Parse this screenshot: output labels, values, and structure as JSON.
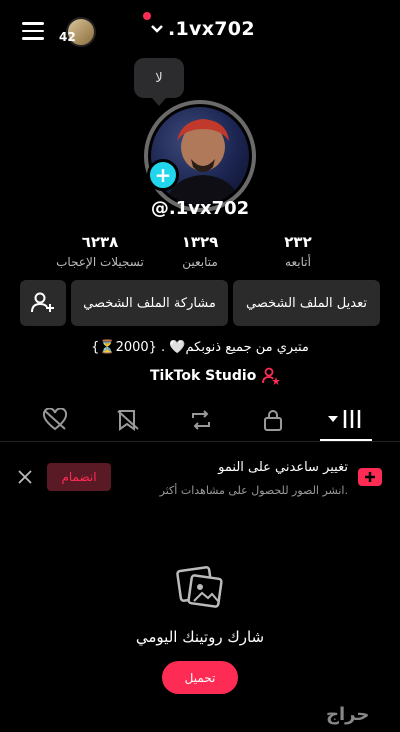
{
  "topbar": {
    "notification_count": "42",
    "username": ".1vx702"
  },
  "story_bubble": {
    "text": "لا"
  },
  "profile": {
    "handle": "@.1vx702"
  },
  "stats": [
    {
      "value": "٦٢٣٨",
      "label": "تسجيلات الإعجاب"
    },
    {
      "value": "١٣٢٩",
      "label": "متابعين"
    },
    {
      "value": "٢٣٢",
      "label": "أتابعه"
    }
  ],
  "actions": {
    "edit_profile": "تعديل الملف الشخصي",
    "share_profile": "مشاركة الملف الشخصي"
  },
  "bio": "متبري من جميع ذنوبكم🤍 .  {2000⏳}",
  "studio_link": "TikTok Studio",
  "promo": {
    "title": "تغيير ساعدني على النمو",
    "subtitle": "انشر الصور للحصول على مشاهدات أكثر.",
    "join_label": "انضمام"
  },
  "empty_state": {
    "title": "شارك روتينك اليومي",
    "cta_label": "تحميل"
  },
  "watermark": "حراج",
  "colors": {
    "accent": "#fe2c55",
    "plus": "#20d5ec",
    "background": "#000000"
  }
}
